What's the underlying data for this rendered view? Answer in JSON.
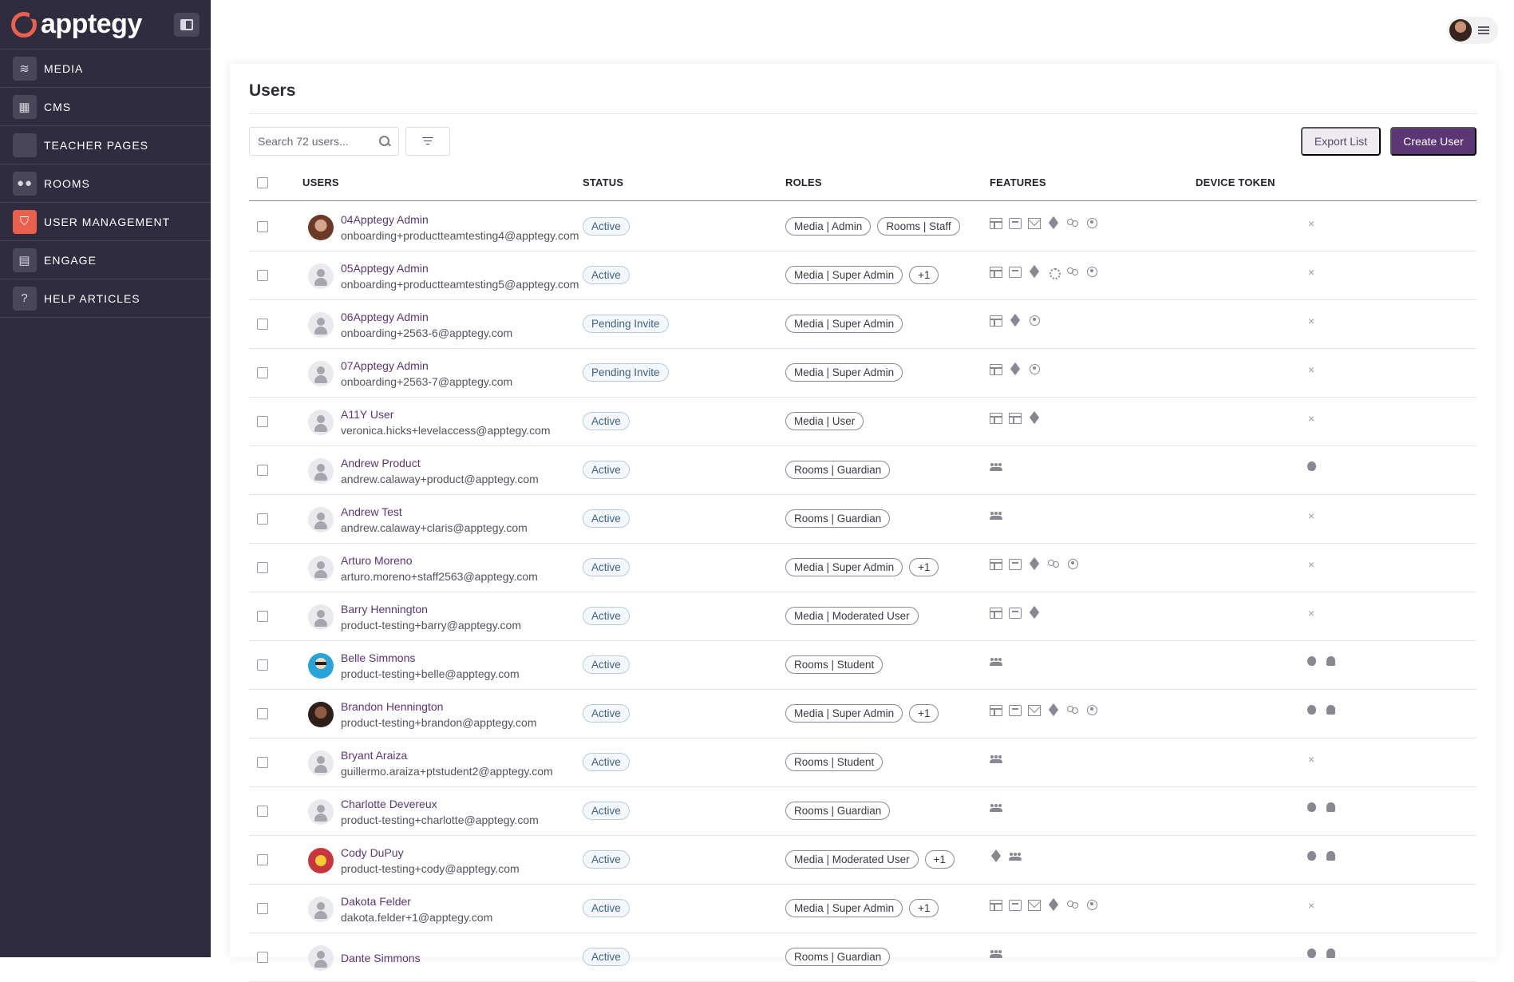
{
  "brand": {
    "name": "apptegy"
  },
  "nav": [
    {
      "label": "MEDIA",
      "icon": "layers-icon"
    },
    {
      "label": "CMS",
      "icon": "layout-icon"
    },
    {
      "label": "TEACHER PAGES",
      "icon": "page-icon"
    },
    {
      "label": "ROOMS",
      "icon": "group-icon"
    },
    {
      "label": "USER MANAGEMENT",
      "icon": "shield-user-icon",
      "active": true
    },
    {
      "label": "ENGAGE",
      "icon": "chat-icon"
    },
    {
      "label": "HELP ARTICLES",
      "icon": "help-icon"
    }
  ],
  "page": {
    "title": "Users"
  },
  "toolbar": {
    "search_placeholder": "Search 72 users...",
    "export_label": "Export List",
    "create_label": "Create User"
  },
  "columns": {
    "users": "USERS",
    "status": "STATUS",
    "roles": "ROLES",
    "features": "FEATURES",
    "device_token": "DEVICE TOKEN"
  },
  "rows": [
    {
      "name": "04Apptegy Admin",
      "email": "onboarding+productteamtesting4@apptegy.com",
      "avatar": "photo1",
      "status": "Active",
      "roles": [
        "Media | Admin",
        "Rooms | Staff"
      ],
      "features": [
        "table",
        "chat",
        "mail",
        "layers",
        "people",
        "user"
      ],
      "tokens": [
        "none"
      ]
    },
    {
      "name": "05Apptegy Admin",
      "email": "onboarding+productteamtesting5@apptegy.com",
      "avatar": "default",
      "status": "Active",
      "roles": [
        "Media | Super Admin",
        "+1"
      ],
      "features": [
        "table",
        "chat",
        "layers",
        "gear",
        "people",
        "user"
      ],
      "tokens": [
        "none"
      ]
    },
    {
      "name": "06Apptegy Admin",
      "email": "onboarding+2563-6@apptegy.com",
      "avatar": "default",
      "status": "Pending Invite",
      "roles": [
        "Media | Super Admin"
      ],
      "features": [
        "table",
        "layers",
        "user"
      ],
      "tokens": [
        "none"
      ]
    },
    {
      "name": "07Apptegy Admin",
      "email": "onboarding+2563-7@apptegy.com",
      "avatar": "default",
      "status": "Pending Invite",
      "roles": [
        "Media | Super Admin"
      ],
      "features": [
        "table",
        "layers",
        "user"
      ],
      "tokens": [
        "none"
      ]
    },
    {
      "name": "A11Y User",
      "email": "veronica.hicks+levelaccess@apptegy.com",
      "avatar": "default",
      "status": "Active",
      "roles": [
        "Media | User"
      ],
      "features": [
        "table",
        "table",
        "layers"
      ],
      "tokens": [
        "none"
      ]
    },
    {
      "name": "Andrew Product",
      "email": "andrew.calaway+product@apptegy.com",
      "avatar": "default",
      "status": "Active",
      "roles": [
        "Rooms | Guardian"
      ],
      "features": [
        "group"
      ],
      "tokens": [
        "apple"
      ]
    },
    {
      "name": "Andrew Test",
      "email": "andrew.calaway+claris@apptegy.com",
      "avatar": "default",
      "status": "Active",
      "roles": [
        "Rooms | Guardian"
      ],
      "features": [
        "group"
      ],
      "tokens": [
        "none"
      ]
    },
    {
      "name": "Arturo Moreno",
      "email": "arturo.moreno+staff2563@apptegy.com",
      "avatar": "default",
      "status": "Active",
      "roles": [
        "Media | Super Admin",
        "+1"
      ],
      "features": [
        "table",
        "chat",
        "layers",
        "people",
        "user"
      ],
      "tokens": [
        "none"
      ]
    },
    {
      "name": "Barry Hennington",
      "email": "product-testing+barry@apptegy.com",
      "avatar": "default",
      "status": "Active",
      "roles": [
        "Media | Moderated User"
      ],
      "features": [
        "table",
        "chat",
        "layers"
      ],
      "tokens": [
        "none"
      ]
    },
    {
      "name": "Belle Simmons",
      "email": "product-testing+belle@apptegy.com",
      "avatar": "photo2",
      "status": "Active",
      "roles": [
        "Rooms | Student"
      ],
      "features": [
        "group"
      ],
      "tokens": [
        "apple",
        "android"
      ]
    },
    {
      "name": "Brandon Hennington",
      "email": "product-testing+brandon@apptegy.com",
      "avatar": "photo3",
      "status": "Active",
      "roles": [
        "Media | Super Admin",
        "+1"
      ],
      "features": [
        "table",
        "chat",
        "mail",
        "layers",
        "people",
        "user"
      ],
      "tokens": [
        "apple",
        "android"
      ]
    },
    {
      "name": "Bryant Araiza",
      "email": "guillermo.araiza+ptstudent2@apptegy.com",
      "avatar": "default",
      "status": "Active",
      "roles": [
        "Rooms | Student"
      ],
      "features": [
        "group"
      ],
      "tokens": [
        "none"
      ]
    },
    {
      "name": "Charlotte Devereux",
      "email": "product-testing+charlotte@apptegy.com",
      "avatar": "default",
      "status": "Active",
      "roles": [
        "Rooms | Guardian"
      ],
      "features": [
        "group"
      ],
      "tokens": [
        "apple",
        "android"
      ]
    },
    {
      "name": "Cody DuPuy",
      "email": "product-testing+cody@apptegy.com",
      "avatar": "photo4",
      "status": "Active",
      "roles": [
        "Media | Moderated User",
        "+1"
      ],
      "features": [
        "layers",
        "group"
      ],
      "tokens": [
        "apple",
        "android"
      ]
    },
    {
      "name": "Dakota Felder",
      "email": "dakota.felder+1@apptegy.com",
      "avatar": "default",
      "status": "Active",
      "roles": [
        "Media | Super Admin",
        "+1"
      ],
      "features": [
        "table",
        "chat",
        "mail",
        "layers",
        "people",
        "user"
      ],
      "tokens": [
        "none"
      ]
    },
    {
      "name": "Dante Simmons",
      "email": "",
      "avatar": "default",
      "status": "Active",
      "roles": [
        "Rooms | Guardian"
      ],
      "features": [
        "group"
      ],
      "tokens": [
        "apple",
        "android"
      ]
    }
  ]
}
